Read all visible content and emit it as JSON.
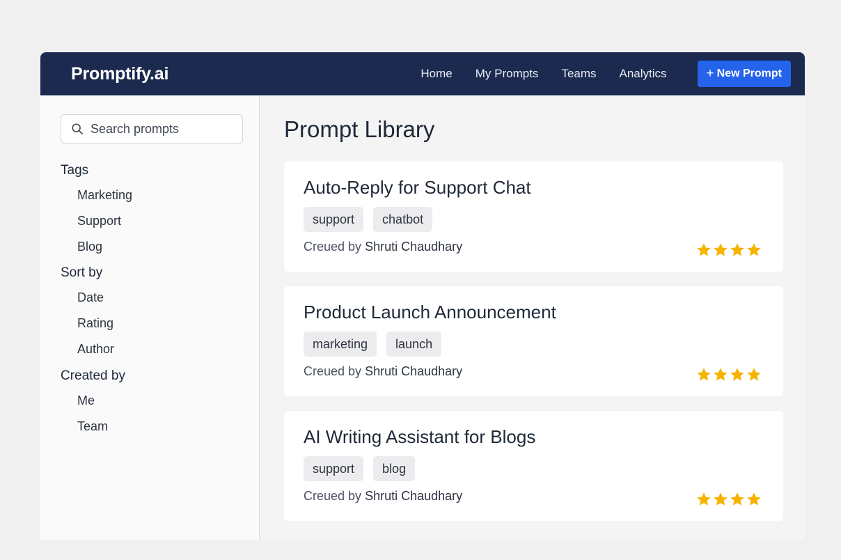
{
  "header": {
    "brand": "Promptify.ai",
    "nav": [
      "Home",
      "My Prompts",
      "Teams",
      "Analytics"
    ],
    "new_button_plus": "+",
    "new_button_label": "New Prompt"
  },
  "sidebar": {
    "search_placeholder": "Search prompts",
    "sections": [
      {
        "title": "Tags",
        "items": [
          "Marketing",
          "Support",
          "Blog"
        ]
      },
      {
        "title": "Sort by",
        "items": [
          "Date",
          "Rating",
          "Author"
        ]
      },
      {
        "title": "Created by",
        "items": [
          "Me",
          "Team"
        ]
      }
    ]
  },
  "main": {
    "title": "Prompt Library",
    "cards": [
      {
        "title": "Auto-Reply for Support Chat",
        "tags": [
          "support",
          "chatbot"
        ],
        "author_prefix": "Creued by",
        "author": "Shruti Chaudhary",
        "rating": 4
      },
      {
        "title": "Product Launch Announcement",
        "tags": [
          "marketing",
          "launch"
        ],
        "author_prefix": "Creued by",
        "author": "Shruti Chaudhary",
        "rating": 4
      },
      {
        "title": "AI Writing Assistant for Blogs",
        "tags": [
          "support",
          "blog"
        ],
        "author_prefix": "Creued by",
        "author": "Shruti Chaudhary",
        "rating": 4
      }
    ]
  },
  "colors": {
    "header_bg": "#1c2a4f",
    "accent": "#2563eb",
    "star": "#f6b400"
  },
  "icons": {
    "search": "search-icon",
    "rating": "star-icon"
  }
}
